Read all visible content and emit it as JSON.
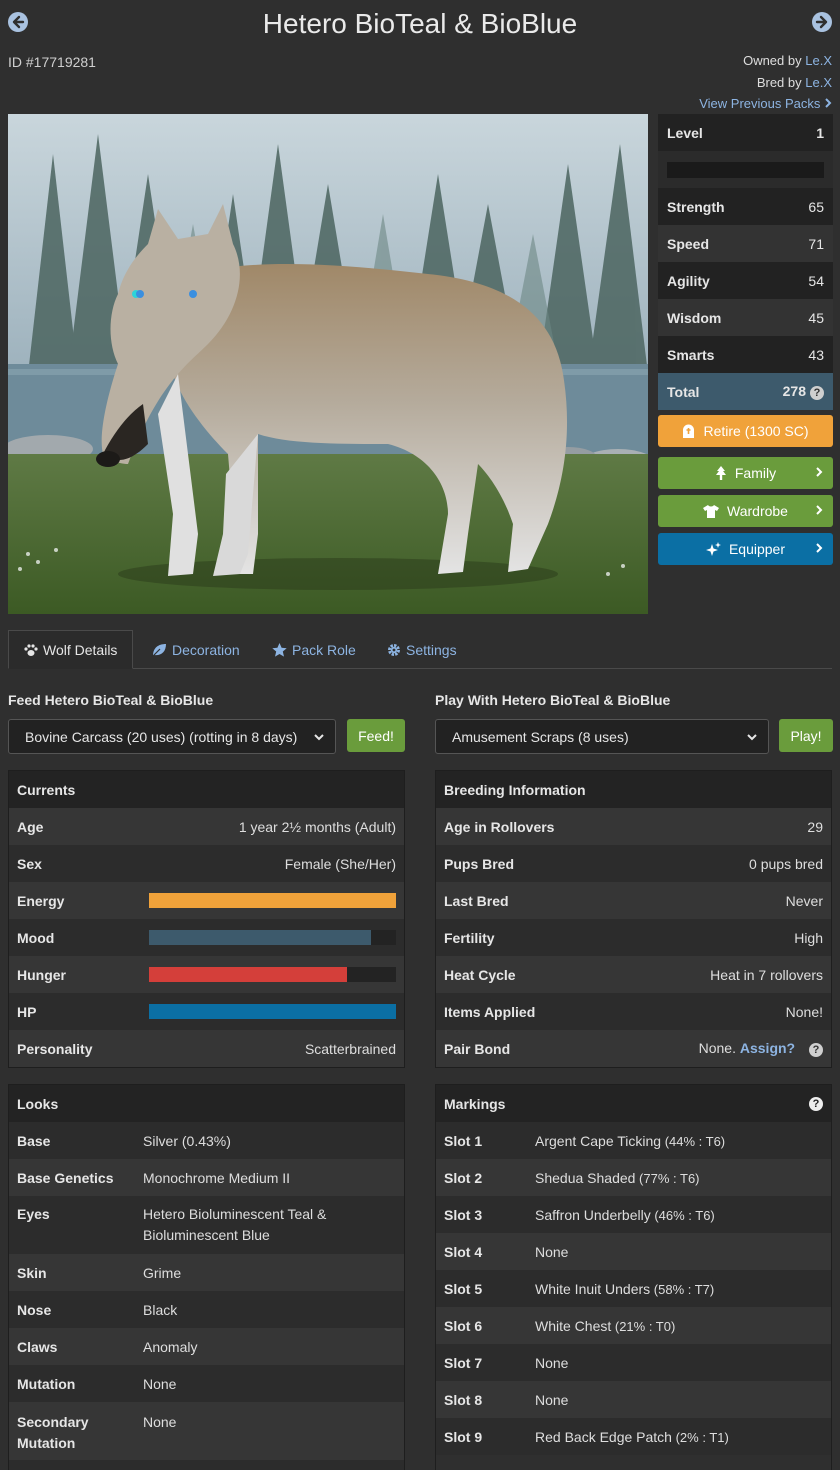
{
  "header": {
    "title": "Hetero BioTeal & BioBlue",
    "id_text": "ID #17719281",
    "owned_by_label": "Owned by",
    "owned_by_name": "Le.X",
    "bred_by_label": "Bred by",
    "bred_by_name": "Le.X",
    "previous_packs": "View Previous Packs"
  },
  "stats": {
    "level_label": "Level",
    "level_value": "1",
    "level_progress": 0,
    "rows": [
      {
        "label": "Strength",
        "value": "65"
      },
      {
        "label": "Speed",
        "value": "71"
      },
      {
        "label": "Agility",
        "value": "54"
      },
      {
        "label": "Wisdom",
        "value": "45"
      },
      {
        "label": "Smarts",
        "value": "43"
      }
    ],
    "total_label": "Total",
    "total_value": "278"
  },
  "actions": {
    "retire": "Retire (1300 SC)",
    "family": "Family",
    "wardrobe": "Wardrobe",
    "equipper": "Equipper"
  },
  "tabs": [
    "Wolf Details",
    "Decoration",
    "Pack Role",
    "Settings"
  ],
  "feed": {
    "label": "Feed Hetero BioTeal & BioBlue",
    "selected": "Bovine Carcass (20 uses) (rotting in 8 days)",
    "button": "Feed!"
  },
  "play": {
    "label": "Play With Hetero BioTeal & BioBlue",
    "selected": "Amusement Scraps (8 uses)",
    "button": "Play!"
  },
  "currents": {
    "title": "Currents",
    "age_label": "Age",
    "age_value": "1 year 2½ months (Adult)",
    "sex_label": "Sex",
    "sex_value": "Female (She/Her)",
    "energy_label": "Energy",
    "energy_level": 1.0,
    "mood_label": "Mood",
    "mood_level": 0.9,
    "hunger_label": "Hunger",
    "hunger_level": 0.8,
    "hp_label": "HP",
    "hp_level": 1.0,
    "personality_label": "Personality",
    "personality_value": "Scatterbrained",
    "colors": {
      "energy": "#f0a23a",
      "mood": "#3d5a6c",
      "hunger": "#d43f3a",
      "hp": "#0b6fa4"
    }
  },
  "breeding": {
    "title": "Breeding Information",
    "rows": [
      {
        "label": "Age in Rollovers",
        "value": "29"
      },
      {
        "label": "Pups Bred",
        "value": "0 pups bred"
      },
      {
        "label": "Last Bred",
        "value": "Never"
      },
      {
        "label": "Fertility",
        "value": "High"
      },
      {
        "label": "Heat Cycle",
        "value": "Heat in 7 rollovers"
      },
      {
        "label": "Items Applied",
        "value": "None!"
      }
    ],
    "pair_bond_label": "Pair Bond",
    "pair_bond_value": "None.",
    "pair_bond_link": "Assign?"
  },
  "looks": {
    "title": "Looks",
    "base_label": "Base",
    "base_value": "Silver (0.43%)",
    "base_genetics_label": "Base Genetics",
    "base_genetics_value": "Monochrome Medium II",
    "eyes_label": "Eyes",
    "eyes_line1": "Hetero Bioluminescent Teal &",
    "eyes_line2": "Bioluminescent Blue",
    "skin_label": "Skin",
    "skin_value": "Grime",
    "nose_label": "Nose",
    "nose_value": "Black",
    "claws_label": "Claws",
    "claws_value": "Anomaly",
    "mutation_label": "Mutation",
    "mutation_value": "None",
    "secondary_label_1": "Secondary",
    "secondary_label_2": "Mutation",
    "secondary_value": "None"
  },
  "markings": {
    "title": "Markings",
    "slots": [
      {
        "label": "Slot 1",
        "name": "Argent Cape Ticking",
        "detail": "(44% : T6)"
      },
      {
        "label": "Slot 2",
        "name": "Shedua Shaded",
        "detail": "(77% : T6)"
      },
      {
        "label": "Slot 3",
        "name": "Saffron Underbelly",
        "detail": "(46% : T6)"
      },
      {
        "label": "Slot 4",
        "name": "None",
        "detail": ""
      },
      {
        "label": "Slot 5",
        "name": "White Inuit Unders",
        "detail": "(58% : T7)"
      },
      {
        "label": "Slot 6",
        "name": "White Chest",
        "detail": "(21% : T0)"
      },
      {
        "label": "Slot 7",
        "name": "None",
        "detail": ""
      },
      {
        "label": "Slot 8",
        "name": "None",
        "detail": ""
      },
      {
        "label": "Slot 9",
        "name": "Red Back Edge Patch",
        "detail": "(2% : T1)"
      }
    ]
  }
}
